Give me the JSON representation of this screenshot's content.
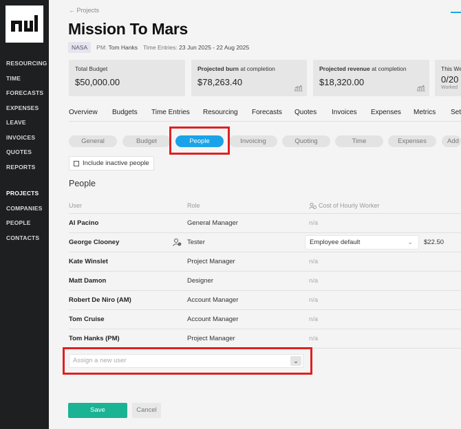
{
  "sidebar": {
    "top_items": [
      "RESOURCING",
      "TIME",
      "FORECASTS",
      "EXPENSES",
      "LEAVE",
      "INVOICES",
      "QUOTES",
      "REPORTS"
    ],
    "bottom_items": [
      "PROJECTS",
      "COMPANIES",
      "PEOPLE",
      "CONTACTS"
    ],
    "active": "PROJECTS"
  },
  "header": {
    "back_link": "← Projects",
    "title": "Mission To Mars",
    "client": "NASA",
    "pm_label": "PM:",
    "pm_value": "Tom Hanks",
    "time_label": "Time Entries:",
    "time_value": "23 Jun 2025 - 22 Aug 2025"
  },
  "cards": [
    {
      "label_bold": "",
      "label": "Total Budget",
      "value": "$50,000.00"
    },
    {
      "label_bold": "Projected burn",
      "label": " at completion",
      "value": "$78,263.40"
    },
    {
      "label_bold": "Projected revenue",
      "label": " at completion",
      "value": "$18,320.00"
    },
    {
      "label_bold": "",
      "label": "This We",
      "value": "0/20",
      "sub": "Worked"
    }
  ],
  "tabs": [
    "Overview",
    "Budgets",
    "Time Entries",
    "Resourcing",
    "Forecasts",
    "Quotes",
    "Invoices",
    "Expenses",
    "Metrics",
    "Setti"
  ],
  "pills": [
    "General",
    "Budget",
    "People",
    "Invoicing",
    "Quoting",
    "Time",
    "Expenses",
    "Add"
  ],
  "active_pill": "People",
  "checkbox_label": "Include inactive people",
  "section_title": "People",
  "table": {
    "headers": [
      "User",
      "Role",
      "Cost of Hourly Worker"
    ],
    "rows": [
      {
        "user": "Al Pacino",
        "role": "General Manager",
        "cost": "n/a"
      },
      {
        "user": "George Clooney",
        "role": "Tester",
        "cost": "Employee default",
        "rate": "$22.50"
      },
      {
        "user": "Kate Winslet",
        "role": "Project Manager",
        "cost": "n/a"
      },
      {
        "user": "Matt Damon",
        "role": "Designer",
        "cost": "n/a"
      },
      {
        "user": "Robert De Niro (AM)",
        "role": "Account Manager",
        "cost": "n/a"
      },
      {
        "user": "Tom Cruise",
        "role": "Account Manager",
        "cost": "n/a"
      },
      {
        "user": "Tom Hanks (PM)",
        "role": "Project Manager",
        "cost": "n/a"
      }
    ]
  },
  "assign_placeholder": "Assign a new user",
  "buttons": {
    "save": "Save",
    "cancel": "Cancel"
  },
  "colors": {
    "accent": "#1aa3e8",
    "save": "#1ab394",
    "highlight": "#e02020",
    "sidebar": "#1e1f20"
  }
}
